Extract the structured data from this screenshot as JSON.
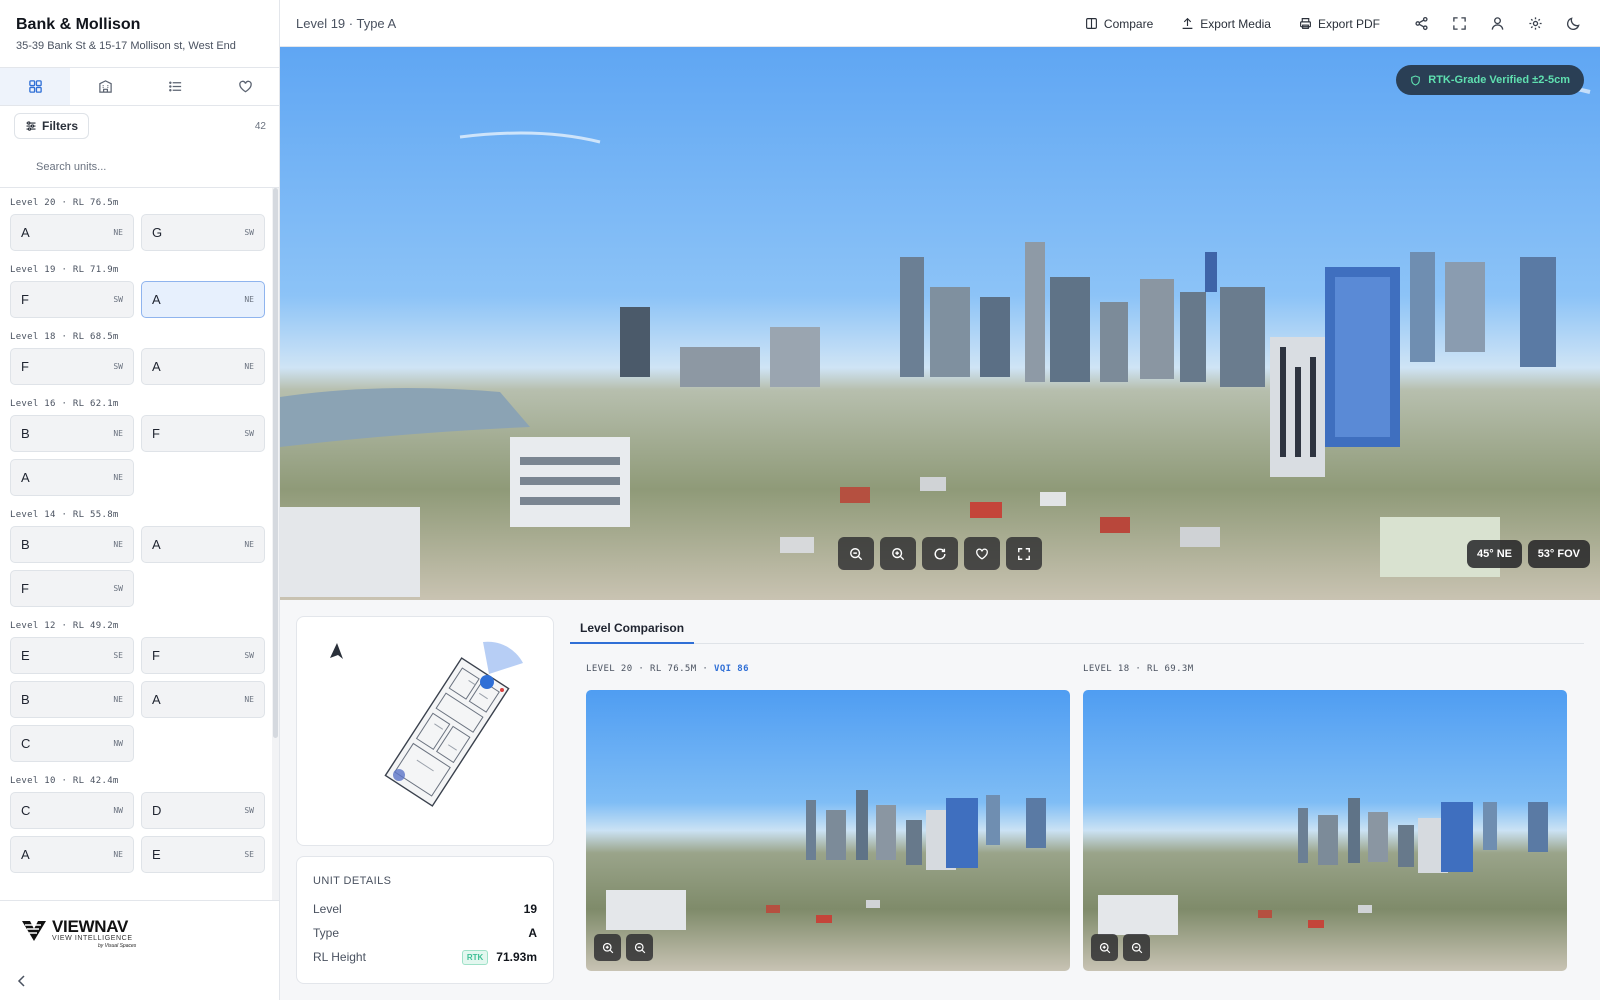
{
  "project": {
    "title": "Bank & Mollison",
    "address": "35-39 Bank St & 15-17 Mollison st, West End"
  },
  "sidebar": {
    "tabs": [
      {
        "name": "grid-icon",
        "active": true
      },
      {
        "name": "building-icon",
        "active": false
      },
      {
        "name": "list-icon",
        "active": false
      },
      {
        "name": "heart-icon",
        "active": false
      }
    ],
    "filters_label": "Filters",
    "unit_count": "42",
    "search_placeholder": "Search units...",
    "levels": [
      {
        "label": "Level 20 · RL 76.5m",
        "units": [
          {
            "type": "A",
            "orient": "NE"
          },
          {
            "type": "G",
            "orient": "SW"
          }
        ]
      },
      {
        "label": "Level 19 · RL 71.9m",
        "units": [
          {
            "type": "F",
            "orient": "SW"
          },
          {
            "type": "A",
            "orient": "NE",
            "selected": true
          }
        ]
      },
      {
        "label": "Level 18 · RL 68.5m",
        "units": [
          {
            "type": "F",
            "orient": "SW"
          },
          {
            "type": "A",
            "orient": "NE"
          }
        ]
      },
      {
        "label": "Level 16 · RL 62.1m",
        "units": [
          {
            "type": "B",
            "orient": "NE"
          },
          {
            "type": "F",
            "orient": "SW"
          },
          {
            "type": "A",
            "orient": "NE"
          }
        ]
      },
      {
        "label": "Level 14 · RL 55.8m",
        "units": [
          {
            "type": "B",
            "orient": "NE"
          },
          {
            "type": "A",
            "orient": "NE"
          },
          {
            "type": "F",
            "orient": "SW"
          }
        ]
      },
      {
        "label": "Level 12 · RL 49.2m",
        "units": [
          {
            "type": "E",
            "orient": "SE"
          },
          {
            "type": "F",
            "orient": "SW"
          },
          {
            "type": "B",
            "orient": "NE"
          },
          {
            "type": "A",
            "orient": "NE"
          },
          {
            "type": "C",
            "orient": "NW"
          }
        ]
      },
      {
        "label": "Level 10 · RL 42.4m",
        "units": [
          {
            "type": "C",
            "orient": "NW"
          },
          {
            "type": "D",
            "orient": "SW"
          },
          {
            "type": "A",
            "orient": "NE"
          },
          {
            "type": "E",
            "orient": "SE"
          }
        ]
      }
    ],
    "logo": {
      "word": "VIEWNAV",
      "sub": "VIEW INTELLIGENCE",
      "by": "by Visual Spaces"
    }
  },
  "topbar": {
    "breadcrumb": "Level 19 · Type A",
    "compare_label": "Compare",
    "export_media_label": "Export Media",
    "export_pdf_label": "Export PDF"
  },
  "hero": {
    "rtk_badge": "RTK-Grade Verified ±2-5cm",
    "heading_chip": "45° NE",
    "fov_chip": "53° FOV"
  },
  "unit_details": {
    "title": "UNIT DETAILS",
    "rows": [
      {
        "key": "Level",
        "value": "19"
      },
      {
        "key": "Type",
        "value": "A"
      },
      {
        "key": "RL Height",
        "value": "71.93m",
        "tag": "RTK"
      }
    ]
  },
  "comparison": {
    "tab_label": "Level Comparison",
    "left_label": "LEVEL 20 · RL 76.5M · ",
    "left_vqi": "VQI 86",
    "right_label": "LEVEL 18 · RL 69.3M"
  },
  "colors": {
    "accent": "#2f6fd6",
    "rtk_green": "#5fe0b0",
    "badge_bg": "#2a3f55"
  }
}
